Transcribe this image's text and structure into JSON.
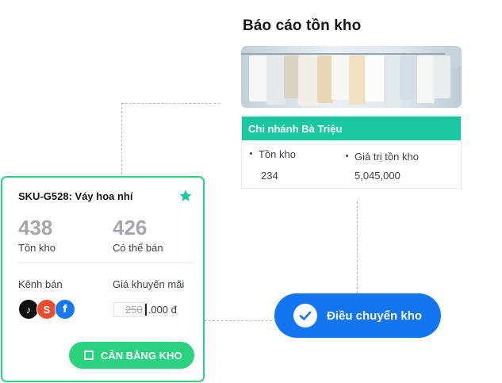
{
  "report": {
    "title": "Báo cáo tồn kho",
    "branch_name": "Chi nhánh Bà Triệu",
    "stock_label": "Tồn kho",
    "stock_value": "234",
    "value_label": "Giá trị tồn kho",
    "value_amount": "5,045,000"
  },
  "transfer_button": {
    "label": "Điều chuyển kho",
    "color": "#1276f2"
  },
  "product": {
    "sku_title": "SKU-G528: Váy hoa nhí",
    "in_stock_value": "438",
    "in_stock_label": "Tồn kho",
    "sellable_value": "426",
    "sellable_label": "Có thể bán",
    "channels_label": "Kênh bán",
    "channels": [
      {
        "icon": "tiktok-icon",
        "glyph": "♪",
        "color": "#111111"
      },
      {
        "icon": "shopee-icon",
        "glyph": "S",
        "color": "#ee4d2d"
      },
      {
        "icon": "facebook-icon",
        "glyph": "f",
        "color": "#1877f2"
      }
    ],
    "promo_label": "Giá khuyến mãi",
    "promo_old": "250",
    "promo_rest": ".000 đ",
    "balance_button": "CÂN BẰNG KHO",
    "accent": "#2ad17f",
    "star_color": "#19c8a0"
  }
}
